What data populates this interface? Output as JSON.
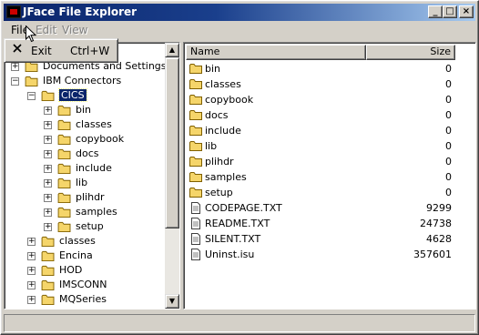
{
  "window": {
    "title": "JFace File Explorer",
    "controls": {
      "minimize": "_",
      "maximize": "□",
      "close": "×"
    }
  },
  "menubar": {
    "file": "File",
    "edit": "Edit",
    "view": "View"
  },
  "file_menu": {
    "items": [
      {
        "label": "Exit",
        "accelerator": "Ctrl+W",
        "icon": "close-x-icon"
      }
    ]
  },
  "tree": {
    "items": [
      {
        "label": "Documents and Settings",
        "expanded": false
      },
      {
        "label": "IBM Connectors",
        "expanded": true
      },
      {
        "label": "CICS",
        "expanded": true,
        "selected": true
      },
      {
        "label": "bin",
        "expanded": false
      },
      {
        "label": "classes",
        "expanded": false
      },
      {
        "label": "copybook",
        "expanded": false
      },
      {
        "label": "docs",
        "expanded": false
      },
      {
        "label": "include",
        "expanded": false
      },
      {
        "label": "lib",
        "expanded": false
      },
      {
        "label": "plihdr",
        "expanded": false
      },
      {
        "label": "samples",
        "expanded": false
      },
      {
        "label": "setup",
        "expanded": false
      },
      {
        "label": "classes",
        "expanded": false
      },
      {
        "label": "Encina",
        "expanded": false
      },
      {
        "label": "HOD",
        "expanded": false
      },
      {
        "label": "IMSCONN",
        "expanded": false
      },
      {
        "label": "MQSeries",
        "expanded": false
      }
    ]
  },
  "table": {
    "columns": {
      "name": "Name",
      "size": "Size"
    },
    "rows": [
      {
        "name": "bin",
        "size": "0",
        "type": "folder"
      },
      {
        "name": "classes",
        "size": "0",
        "type": "folder"
      },
      {
        "name": "copybook",
        "size": "0",
        "type": "folder"
      },
      {
        "name": "docs",
        "size": "0",
        "type": "folder"
      },
      {
        "name": "include",
        "size": "0",
        "type": "folder"
      },
      {
        "name": "lib",
        "size": "0",
        "type": "folder"
      },
      {
        "name": "plihdr",
        "size": "0",
        "type": "folder"
      },
      {
        "name": "samples",
        "size": "0",
        "type": "folder"
      },
      {
        "name": "setup",
        "size": "0",
        "type": "folder"
      },
      {
        "name": "CODEPAGE.TXT",
        "size": "9299",
        "type": "file"
      },
      {
        "name": "README.TXT",
        "size": "24738",
        "type": "file"
      },
      {
        "name": "SILENT.TXT",
        "size": "4628",
        "type": "file"
      },
      {
        "name": "Uninst.isu",
        "size": "357601",
        "type": "file"
      }
    ]
  },
  "colors": {
    "titlebar_start": "#0a246a",
    "titlebar_end": "#a6caf0",
    "selection": "#0a246a",
    "folder": "#f5d56a",
    "window_face": "#d4d0c8"
  }
}
